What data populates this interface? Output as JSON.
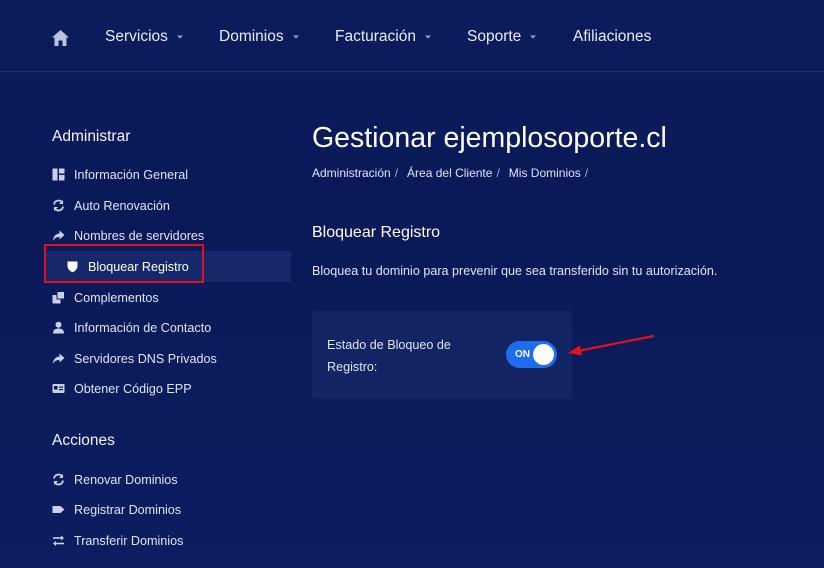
{
  "nav": {
    "items": [
      {
        "label": "Servicios",
        "dropdown": true
      },
      {
        "label": "Dominios",
        "dropdown": true
      },
      {
        "label": "Facturación",
        "dropdown": true
      },
      {
        "label": "Soporte",
        "dropdown": true
      },
      {
        "label": "Afiliaciones",
        "dropdown": false
      }
    ]
  },
  "sidebar": {
    "admin_heading": "Administrar",
    "admin_items": [
      {
        "label": "Información General",
        "icon": "dashboard-icon"
      },
      {
        "label": "Auto Renovación",
        "icon": "sync-icon"
      },
      {
        "label": "Nombres de servidores",
        "icon": "share-arrow-icon"
      },
      {
        "label": "Bloquear Registro",
        "icon": "shield-icon",
        "active": true
      },
      {
        "label": "Complementos",
        "icon": "cubes-icon"
      },
      {
        "label": "Información de Contacto",
        "icon": "user-icon"
      },
      {
        "label": "Servidores DNS Privados",
        "icon": "share-arrow-icon"
      },
      {
        "label": "Obtener Código EPP",
        "icon": "id-card-icon"
      }
    ],
    "actions_heading": "Acciones",
    "action_items": [
      {
        "label": "Renovar Dominios",
        "icon": "sync-icon"
      },
      {
        "label": "Registrar Dominios",
        "icon": "tag-icon"
      },
      {
        "label": "Transferir Dominios",
        "icon": "exchange-icon"
      }
    ]
  },
  "main": {
    "title": "Gestionar ejemplosoporte.cl",
    "breadcrumb": [
      "Administración",
      "Área del Cliente",
      "Mis Dominios"
    ],
    "breadcrumb_separator": "/",
    "section_title": "Bloquear Registro",
    "section_description": "Bloquea tu dominio para prevenir que sea transferido sin tu autorización.",
    "lock_status_label": "Estado de Bloqueo de Registro:",
    "toggle_label": "ON",
    "toggle_on": true
  },
  "colors": {
    "background": "#0b1b5c",
    "toggle_on": "#1e6cf0",
    "highlight_box": "#e0121f",
    "annotation_arrow": "#e0121f"
  }
}
